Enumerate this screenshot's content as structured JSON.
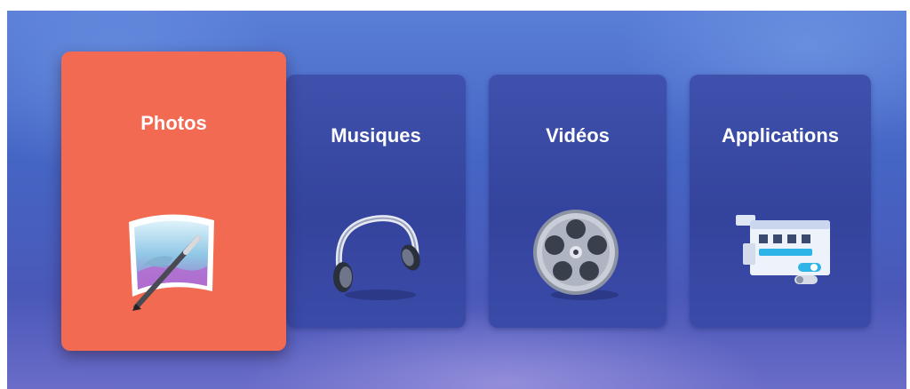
{
  "menu": {
    "tiles": [
      {
        "label": "Photos",
        "icon": "photo-edit-icon",
        "focused": true
      },
      {
        "label": "Musiques",
        "icon": "headphones-icon",
        "focused": false
      },
      {
        "label": "Vidéos",
        "icon": "film-reel-icon",
        "focused": false
      },
      {
        "label": "Applications",
        "icon": "app-windows-icon",
        "focused": false
      }
    ]
  },
  "colors": {
    "focused_tile": "#f26a52",
    "tile": "#3a4aa8",
    "background": "#4a6ac8"
  }
}
